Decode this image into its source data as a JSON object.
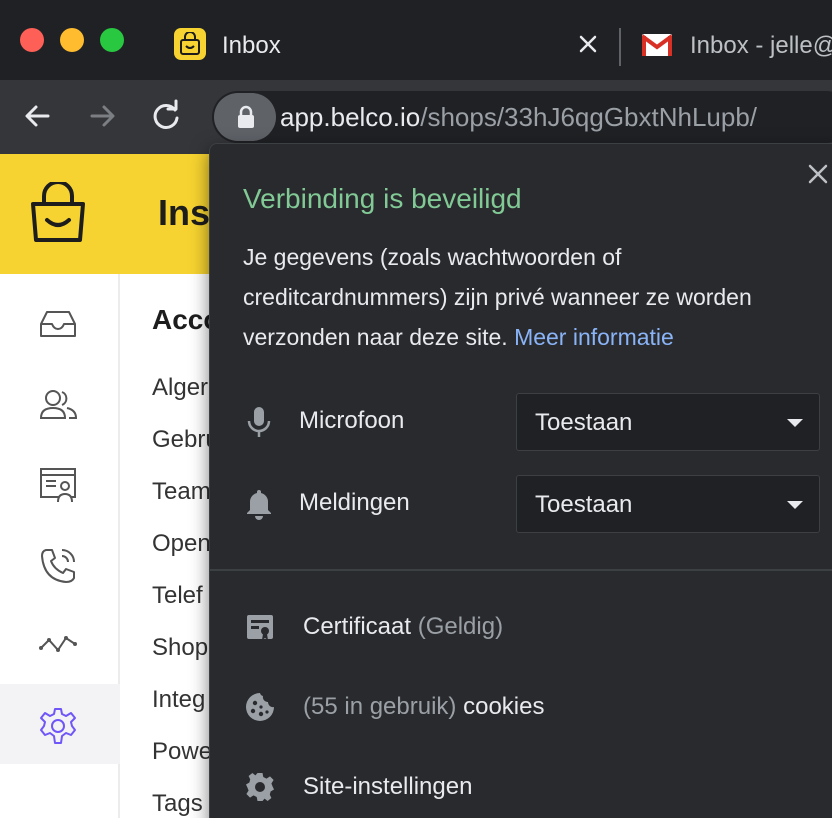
{
  "browser": {
    "tabs": [
      {
        "title": "Inbox",
        "active": true
      },
      {
        "title": "Inbox - jelle@",
        "active": false
      }
    ],
    "url": {
      "host": "app.belco.io",
      "path": "/shops/33hJ6qgGbxtNhLupb/"
    }
  },
  "app": {
    "header_title": "Ins",
    "submenu": {
      "title": "Acco",
      "items": [
        "Alger",
        "Gebru",
        "Team",
        "Open",
        "Telef",
        "Shop",
        "Integ",
        "Powe",
        "Tags"
      ]
    },
    "accent_color": "#f6d330",
    "active_icon_color": "#6e56f8"
  },
  "popup": {
    "title": "Verbinding is beveiligd",
    "description": "Je gegevens (zoals wachtwoorden of creditcardnummers) zijn privé wanneer ze worden verzonden naar deze site.",
    "link": "Meer informatie",
    "permissions": [
      {
        "label": "Microfoon",
        "value": "Toestaan",
        "icon": "microphone-icon"
      },
      {
        "label": "Meldingen",
        "value": "Toestaan",
        "icon": "bell-icon"
      }
    ],
    "certificate": {
      "label": "Certificaat",
      "status": "(Geldig)"
    },
    "cookies": {
      "count": "(55 in gebruik)",
      "label": "cookies"
    },
    "site_settings": "Site-instellingen",
    "secure_color": "#81c995"
  }
}
